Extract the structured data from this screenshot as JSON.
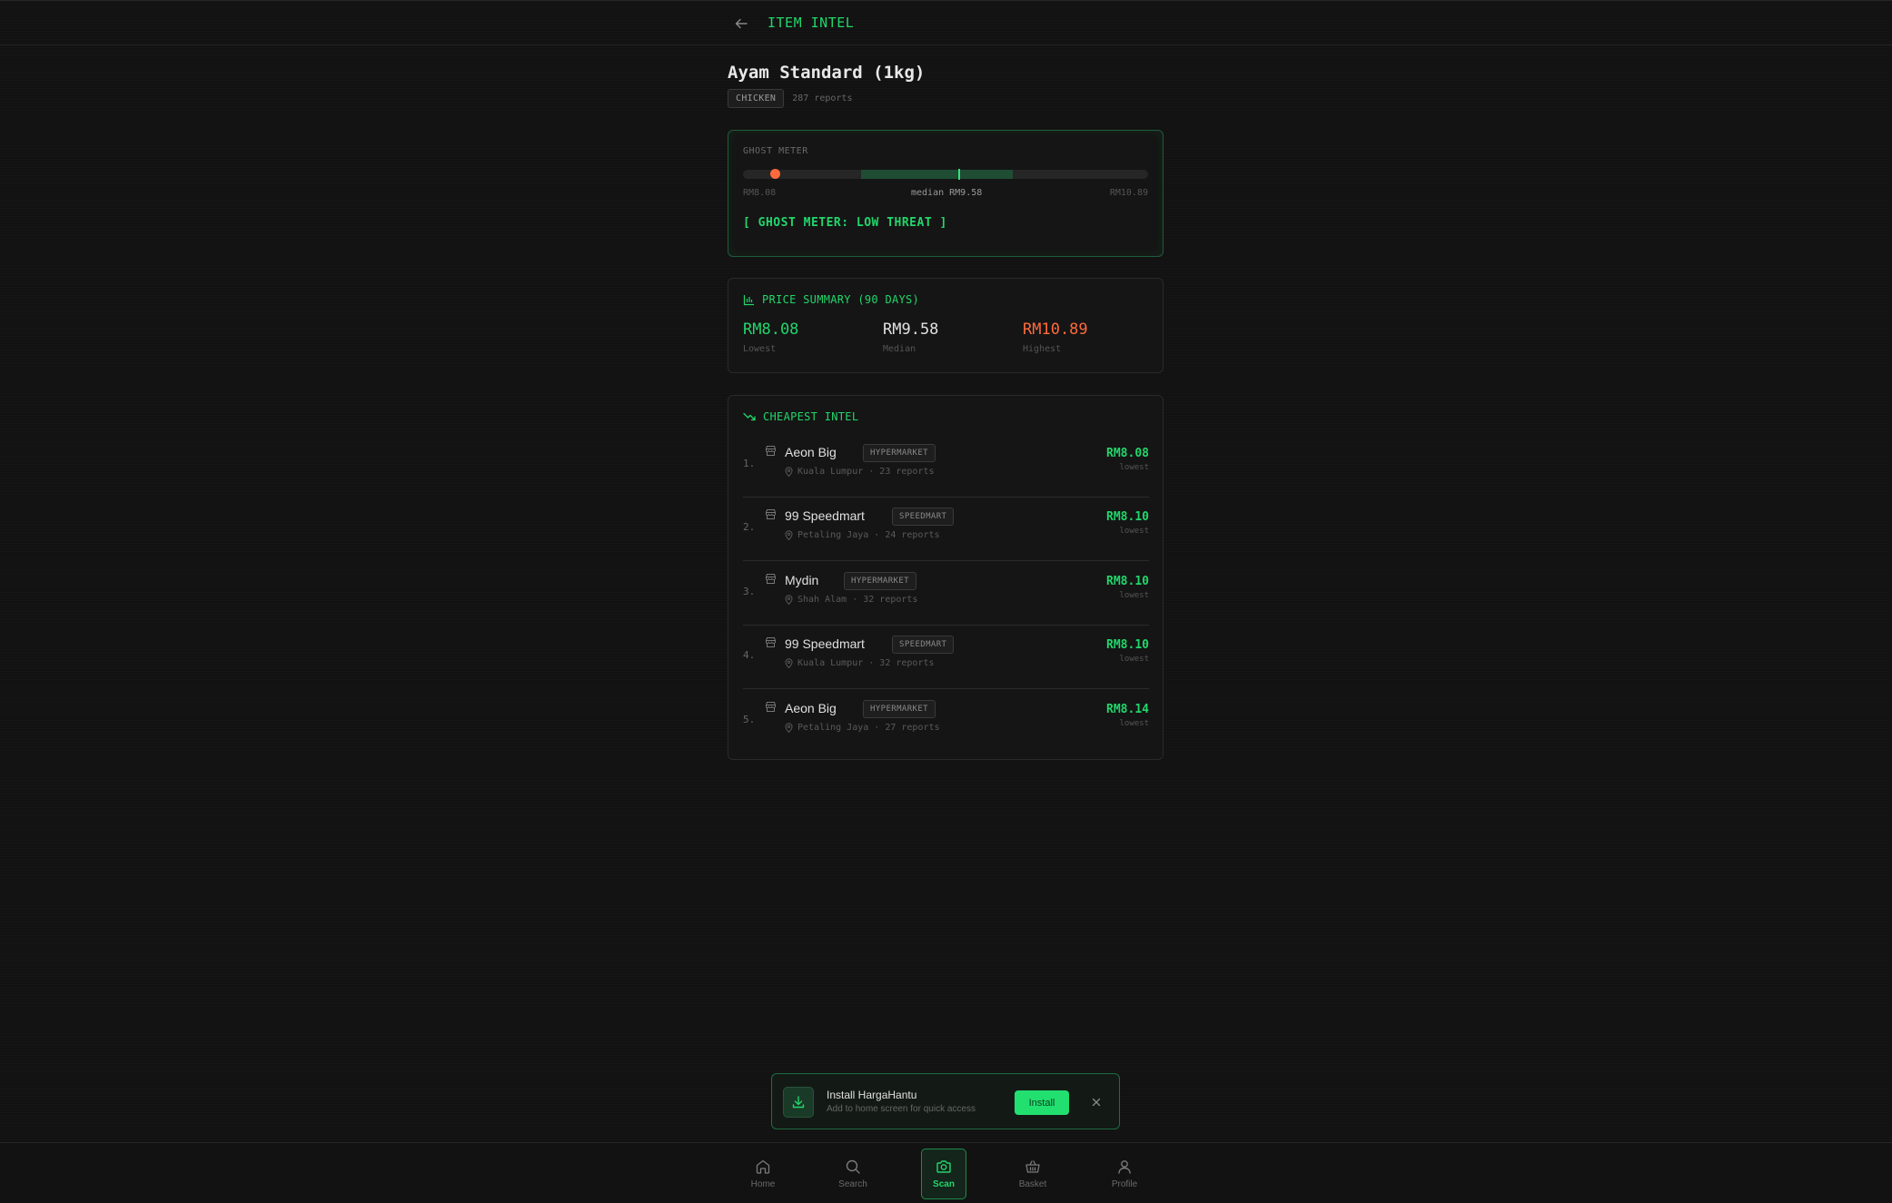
{
  "header": {
    "title": "ITEM INTEL"
  },
  "item": {
    "name": "Ayam Standard (1kg)",
    "category": "CHICKEN",
    "reports": "287 reports"
  },
  "ghost_meter": {
    "label": "GHOST METER",
    "low_label": "RM8.08",
    "median_label": "median RM9.58",
    "high_label": "RM10.89",
    "threat": "[ GHOST METER: LOW THREAT ]",
    "current_value": 8.3,
    "min": 8.08,
    "max": 10.89,
    "median": 9.58,
    "band_low": 8.9,
    "band_high": 9.95,
    "colors": {
      "dot": "#ff6a3d",
      "band": "#1f4d34",
      "accent": "#22d66b"
    }
  },
  "summary": {
    "title": "PRICE SUMMARY (90 DAYS)",
    "stats": [
      {
        "value": "RM8.08",
        "label": "Lowest",
        "color": "#22d66b"
      },
      {
        "value": "RM9.58",
        "label": "Median",
        "color": "#e0e0e0"
      },
      {
        "value": "RM10.89",
        "label": "Highest",
        "color": "#ff6a3d"
      }
    ]
  },
  "cheapest": {
    "title": "CHEAPEST INTEL",
    "rows": [
      {
        "rank": "1.",
        "store": "Aeon Big",
        "type": "HYPERMARKET",
        "location": "Kuala Lumpur · 23 reports",
        "price": "RM8.08",
        "price_label": "lowest"
      },
      {
        "rank": "2.",
        "store": "99 Speedmart",
        "type": "SPEEDMART",
        "location": "Petaling Jaya · 24 reports",
        "price": "RM8.10",
        "price_label": "lowest"
      },
      {
        "rank": "3.",
        "store": "Mydin",
        "type": "HYPERMARKET",
        "location": "Shah Alam · 32 reports",
        "price": "RM8.10",
        "price_label": "lowest"
      },
      {
        "rank": "4.",
        "store": "99 Speedmart",
        "type": "SPEEDMART",
        "location": "Kuala Lumpur · 32 reports",
        "price": "RM8.10",
        "price_label": "lowest"
      },
      {
        "rank": "5.",
        "store": "Aeon Big",
        "type": "HYPERMARKET",
        "location": "Petaling Jaya · 27 reports",
        "price": "RM8.14",
        "price_label": "lowest"
      }
    ]
  },
  "install_banner": {
    "title": "Install HargaHantu",
    "subtitle": "Add to home screen for quick access",
    "button": "Install"
  },
  "nav": {
    "items": [
      {
        "label": "Home",
        "icon": "home-icon"
      },
      {
        "label": "Search",
        "icon": "search-icon"
      },
      {
        "label": "Scan",
        "icon": "camera-icon",
        "active": true
      },
      {
        "label": "Basket",
        "icon": "basket-icon"
      },
      {
        "label": "Profile",
        "icon": "user-icon"
      }
    ]
  }
}
